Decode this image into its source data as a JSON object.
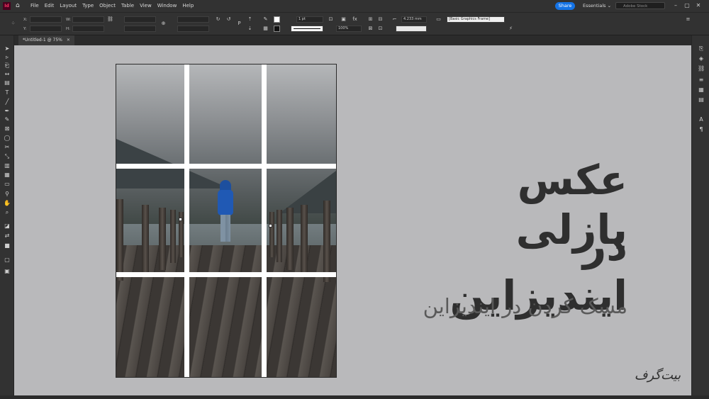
{
  "menubar": {
    "logo": "Id",
    "items": [
      "File",
      "Edit",
      "Layout",
      "Type",
      "Object",
      "Table",
      "View",
      "Window",
      "Help"
    ],
    "share": "Share",
    "workspace": "Essentials",
    "stock_placeholder": "Adobe Stock"
  },
  "control": {
    "x_label": "X:",
    "y_label": "Y:",
    "w_label": "W:",
    "h_label": "H:",
    "stroke_weight": "1 pt",
    "zoom": "100%",
    "dimension": "4.233 mm",
    "object_style": "[Basic Graphics Frame]"
  },
  "document": {
    "tab_label": "*Untitled-1 @ 75%",
    "title_line1": "عکس پازلی",
    "title_line2": "در ایندیزاین",
    "subtitle": "مسک کردن در ایندیزاین",
    "watermark": "بیت‌گرف"
  },
  "colors": {
    "accent": "#1473e6",
    "canvas": "#b9b9bb",
    "chrome": "#323232"
  },
  "icons": {
    "tools": [
      "selection-icon",
      "direct-selection-icon",
      "page-icon",
      "gap-icon",
      "content-collector-icon",
      "type-icon",
      "line-icon",
      "pen-icon",
      "pencil-icon",
      "rectangle-frame-icon",
      "rectangle-icon",
      "ellipse-icon",
      "scissors-icon",
      "free-transform-icon",
      "gradient-icon",
      "gradient-feather-icon",
      "note-icon",
      "eyedropper-icon",
      "hand-icon",
      "zoom-icon",
      "fill-stroke-icon",
      "swap-icon",
      "default-colors-icon",
      "apply-color-icon",
      "normal-mode-icon",
      "screen-mode-icon"
    ],
    "right_panel": [
      "pages-icon",
      "layers-icon",
      "links-icon",
      "stroke-icon",
      "swatches-icon",
      "cc-libraries-icon",
      "character-icon",
      "paragraph-icon"
    ]
  }
}
